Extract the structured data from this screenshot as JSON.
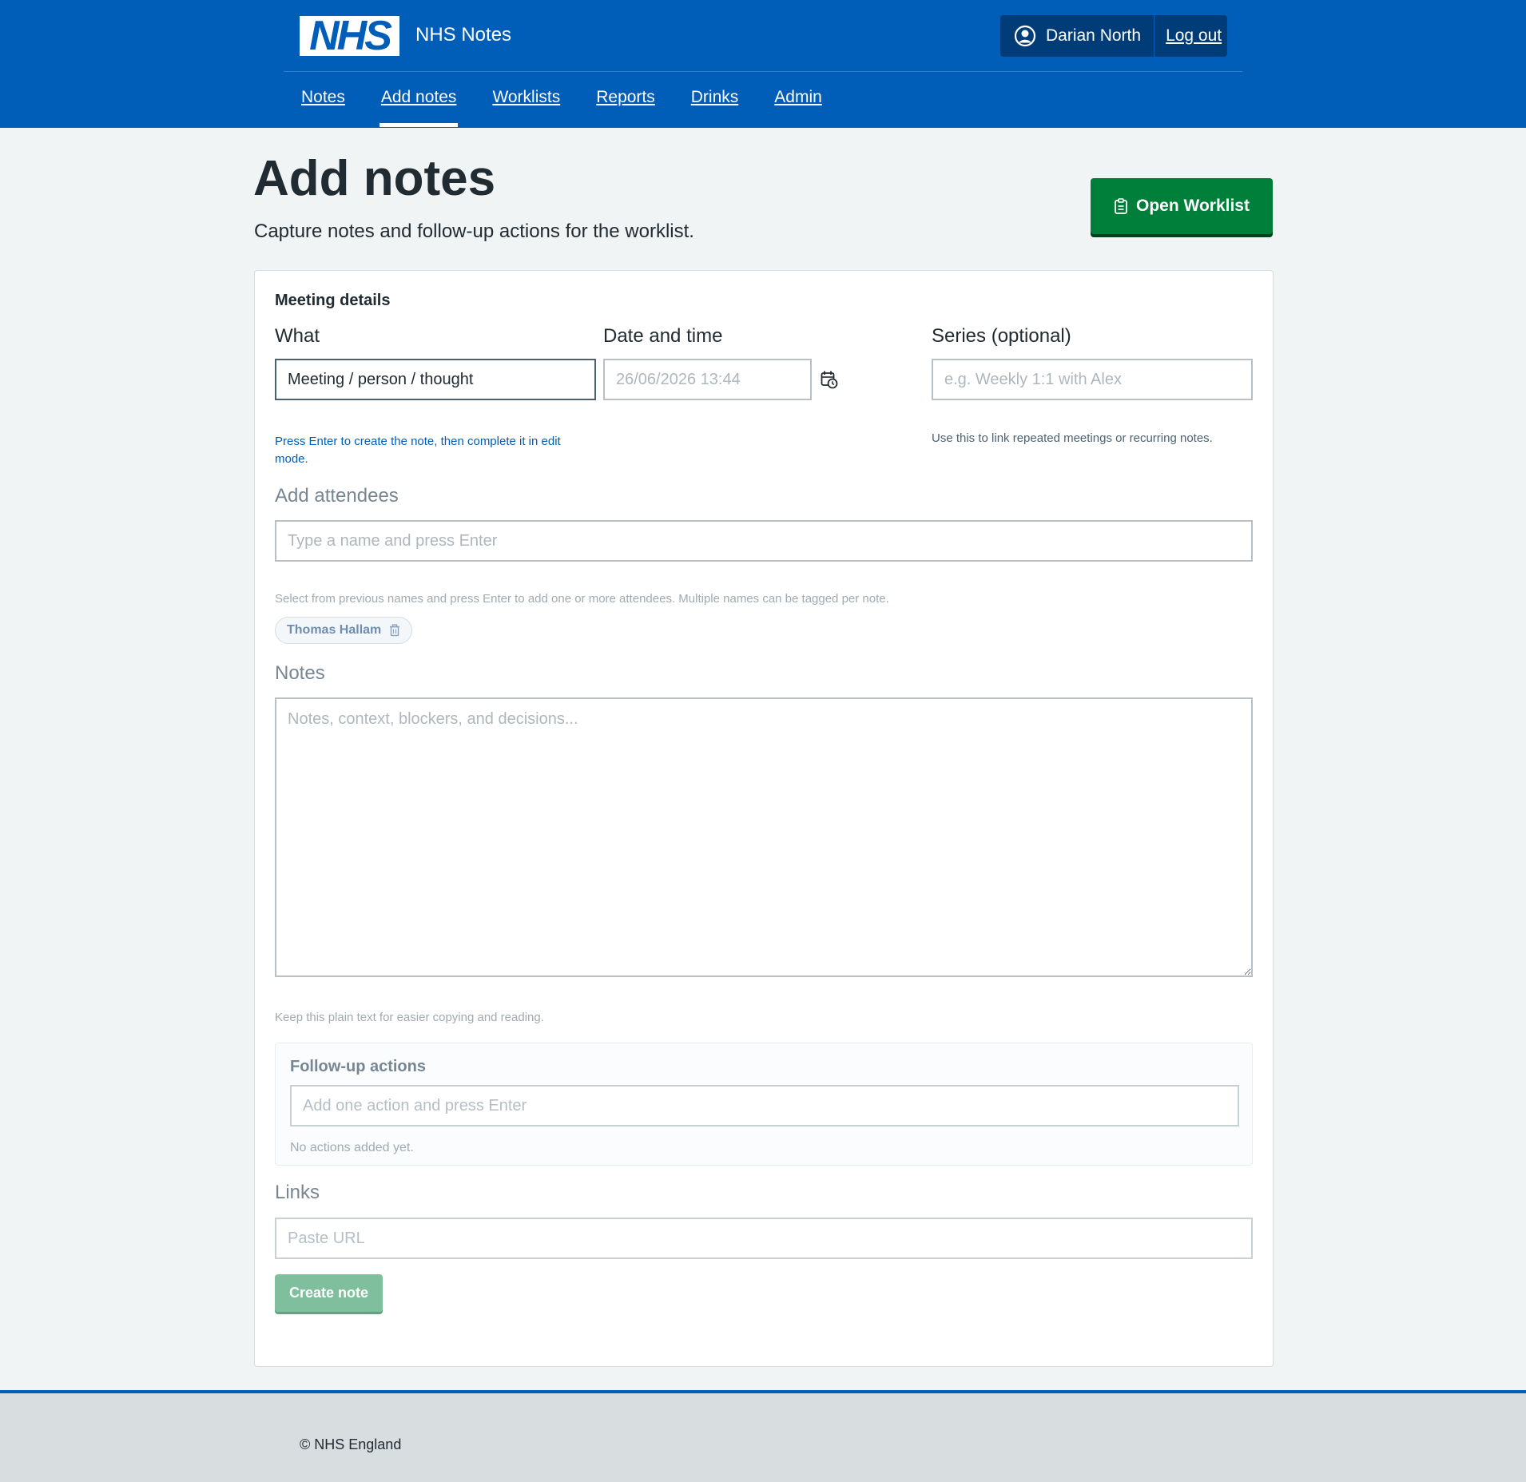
{
  "header": {
    "logo_text": "NHS",
    "service_name": "NHS Notes",
    "user_name": "Darian North",
    "logout_label": "Log out",
    "brand_color": "#005eb8"
  },
  "nav": {
    "items": [
      {
        "label": "Notes",
        "active": false
      },
      {
        "label": "Add notes",
        "active": true
      },
      {
        "label": "Worklists",
        "active": false
      },
      {
        "label": "Reports",
        "active": false
      },
      {
        "label": "Drinks",
        "active": false
      },
      {
        "label": "Admin",
        "active": false
      }
    ]
  },
  "page": {
    "title": "Add notes",
    "lede": "Capture notes and follow-up actions for the worklist.",
    "open_worklist_label": "Open Worklist"
  },
  "form": {
    "section_heading": "Meeting details",
    "what": {
      "label": "What",
      "value": "Meeting / person / thought",
      "hint": "Press Enter to create the note, then complete it in edit mode."
    },
    "datetime": {
      "label": "Date and time",
      "value": "26/06/2026 13:44",
      "icon": "calendar-clock-icon"
    },
    "series": {
      "label": "Series (optional)",
      "placeholder": "e.g. Weekly 1:1 with Alex",
      "hint": "Use this to link repeated meetings or recurring notes."
    },
    "attendees": {
      "label": "Add attendees",
      "placeholder": "Type a name and press Enter",
      "hint": "Select from previous names and press Enter to add one or more attendees. Multiple names can be tagged per note.",
      "tags": [
        "Thomas Hallam"
      ]
    },
    "notes": {
      "label": "Notes",
      "placeholder": "Notes, context, blockers, and decisions...",
      "hint": "Keep this plain text for easier copying and reading."
    },
    "followup": {
      "heading": "Follow-up actions",
      "placeholder": "Add one action and press Enter",
      "empty_text": "No actions added yet."
    },
    "links": {
      "label": "Links",
      "placeholder": "Paste URL"
    },
    "create_label": "Create note"
  },
  "footer": {
    "text": "© NHS England"
  }
}
